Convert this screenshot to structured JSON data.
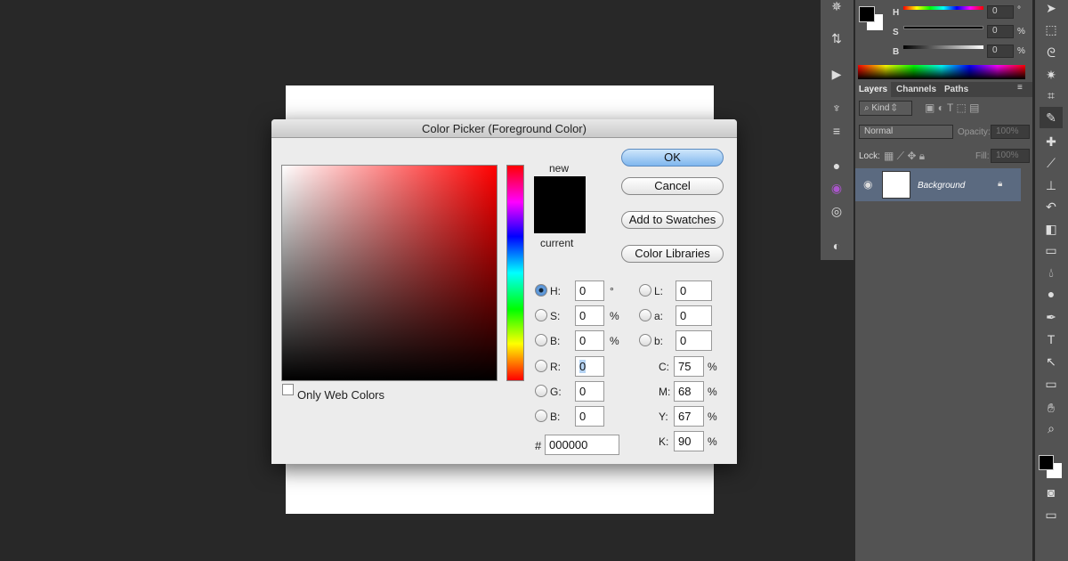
{
  "dialog": {
    "title": "Color Picker (Foreground Color)",
    "new_label": "new",
    "current_label": "current",
    "only_web_colors": "Only Web Colors",
    "only_web_checked": false,
    "buttons": {
      "ok": "OK",
      "cancel": "Cancel",
      "add_swatches": "Add to Swatches",
      "color_libraries": "Color Libraries"
    },
    "fields": {
      "H": {
        "label": "H:",
        "value": "0",
        "unit": "°"
      },
      "S": {
        "label": "S:",
        "value": "0",
        "unit": "%"
      },
      "B": {
        "label": "B:",
        "value": "0",
        "unit": "%"
      },
      "R": {
        "label": "R:",
        "value": "0"
      },
      "G": {
        "label": "G:",
        "value": "0"
      },
      "Bl": {
        "label": "B:",
        "value": "0"
      },
      "L": {
        "label": "L:",
        "value": "0"
      },
      "a": {
        "label": "a:",
        "value": "0"
      },
      "b": {
        "label": "b:",
        "value": "0"
      },
      "C": {
        "label": "C:",
        "value": "75",
        "unit": "%"
      },
      "M": {
        "label": "M:",
        "value": "68",
        "unit": "%"
      },
      "Y": {
        "label": "Y:",
        "value": "67",
        "unit": "%"
      },
      "K": {
        "label": "K:",
        "value": "90",
        "unit": "%"
      },
      "hex_label": "#",
      "hex": "000000"
    },
    "selected_mode": "H",
    "new_color": "#000000",
    "current_color": "#000000"
  },
  "color_panel": {
    "H": {
      "label": "H",
      "value": "0",
      "unit": "°"
    },
    "S": {
      "label": "S",
      "value": "0",
      "unit": "%"
    },
    "B": {
      "label": "B",
      "value": "0",
      "unit": "%"
    }
  },
  "layers_panel": {
    "tabs": [
      "Layers",
      "Channels",
      "Paths"
    ],
    "active_tab": "Layers",
    "kind": "Kind",
    "blend_mode": "Normal",
    "opacity_label": "Opacity:",
    "opacity": "100%",
    "lock_label": "Lock:",
    "fill_label": "Fill:",
    "fill": "100%",
    "layers": [
      {
        "name": "Background",
        "visible": true,
        "locked": true
      }
    ]
  }
}
